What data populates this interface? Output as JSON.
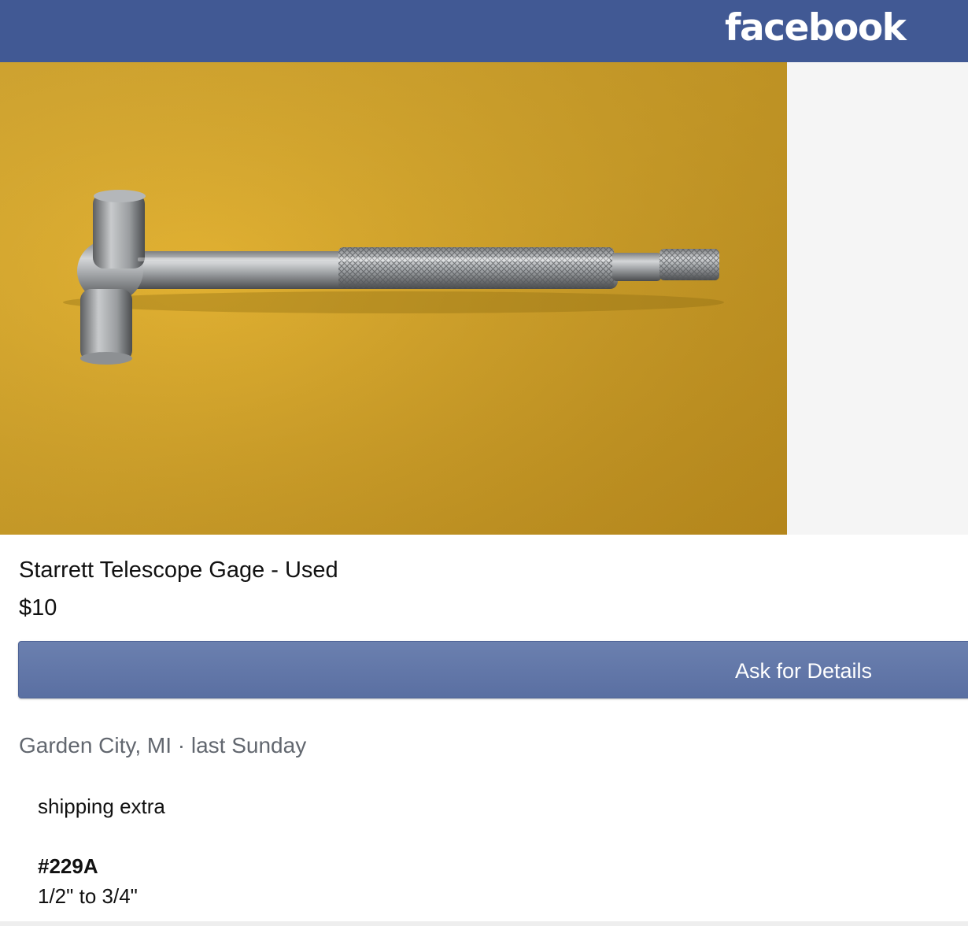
{
  "header": {
    "brand": "facebook",
    "brand_color": "#415994"
  },
  "listing": {
    "photo_alt": "",
    "title": "Starrett Telescope Gage - Used",
    "price": "$10",
    "ask_button_label": "Ask for Details",
    "location": "Garden City, MI",
    "separator": " · ",
    "posted": "last Sunday",
    "description": {
      "line1": "shipping extra",
      "line2": "#229A",
      "line3": "1/2\" to 3/4\""
    }
  }
}
